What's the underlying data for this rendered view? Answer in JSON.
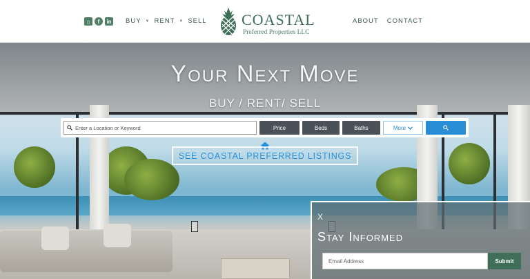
{
  "header": {
    "social": [
      "home-icon",
      "facebook-icon",
      "linkedin-icon"
    ],
    "nav_left": [
      {
        "label": "BUY"
      },
      {
        "label": "RENT"
      },
      {
        "label": "SELL"
      }
    ],
    "logo": {
      "name": "COASTAL",
      "sub": "Preferred Properties LLC"
    },
    "nav_right": [
      {
        "label": "ABOUT"
      },
      {
        "label": "CONTACT"
      }
    ]
  },
  "hero": {
    "title": "Your Next Move",
    "subtitle": "BUY / RENT/ SELL"
  },
  "search": {
    "placeholder": "Enter a Location or Keyword",
    "filters": {
      "price": "Price",
      "beds": "Beds",
      "baths": "Baths",
      "more": "More"
    },
    "go_icon": "search-icon"
  },
  "listings_button": "SEE COASTAL PREFERRED LISTINGS",
  "popup": {
    "close": "X",
    "title": "Stay Informed",
    "email_placeholder": "Email Address",
    "submit": "Submit"
  },
  "colors": {
    "brand_green": "#3f6f58",
    "accent_blue": "#2a8ed6",
    "filter_dark": "#4a5159"
  }
}
